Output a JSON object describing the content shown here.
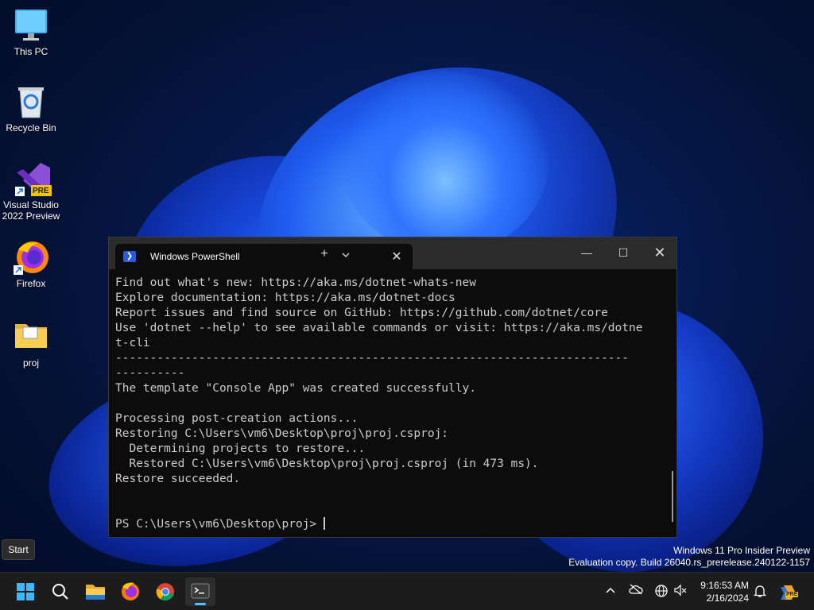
{
  "desktop": {
    "icons": [
      {
        "label": "This PC"
      },
      {
        "label": "Recycle Bin"
      },
      {
        "label": "Visual Studio 2022 Preview",
        "badge": "PRE"
      },
      {
        "label": "Firefox"
      },
      {
        "label": "proj"
      }
    ]
  },
  "window": {
    "tab_title": "Windows PowerShell",
    "tab_close": "✕",
    "new_tab": "+",
    "dropdown": "⌄",
    "minimize": "—",
    "maximize": "☐",
    "close": "✕",
    "console_lines": [
      "Find out what's new: https://aka.ms/dotnet-whats-new",
      "Explore documentation: https://aka.ms/dotnet-docs",
      "Report issues and find source on GitHub: https://github.com/dotnet/core",
      "Use 'dotnet --help' to see available commands or visit: https://aka.ms/dotne",
      "t-cli",
      "--------------------------------------------------------------------------",
      "----------",
      "The template \"Console App\" was created successfully.",
      "",
      "Processing post-creation actions...",
      "Restoring C:\\Users\\vm6\\Desktop\\proj\\proj.csproj:",
      "  Determining projects to restore...",
      "  Restored C:\\Users\\vm6\\Desktop\\proj\\proj.csproj (in 473 ms).",
      "Restore succeeded.",
      "",
      ""
    ],
    "prompt": "PS C:\\Users\\vm6\\Desktop\\proj> "
  },
  "tooltip": {
    "text": "Start"
  },
  "watermark": {
    "line1": "Windows 11 Pro Insider Preview",
    "line2": "Evaluation copy. Build 26040.rs_prerelease.240122-1157"
  },
  "taskbar": {
    "icons": [
      "windows-start-icon",
      "search-icon",
      "file-explorer-icon",
      "firefox-icon",
      "chrome-icon",
      "terminal-icon"
    ],
    "tray_icons": [
      "chevron-up-icon",
      "cloud-icon",
      "network-icon",
      "volume-muted-icon",
      "bell-icon",
      "copilot-icon"
    ],
    "time": "9:16:53 AM",
    "date": "2/16/2024",
    "copilot_badge": "PRE"
  },
  "colors": {
    "accent": "#4cc2ff",
    "terminal_bg": "#0c0c0c",
    "terminal_text": "#cccccc",
    "titlebar": "#2b2b2b",
    "taskbar": "#1c1c1c"
  }
}
